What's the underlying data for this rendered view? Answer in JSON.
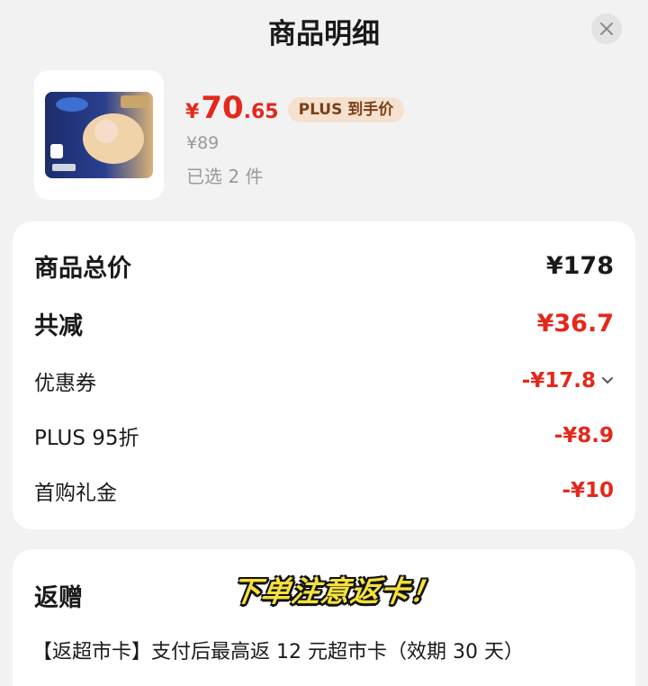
{
  "header": {
    "title": "商品明细",
    "close_icon": "close-icon"
  },
  "product": {
    "price_symbol": "¥",
    "price_integer": "70",
    "price_decimal": ".65",
    "plus_badge": "PLUS 到手价",
    "original_price": "¥89",
    "selected_count": "已选 2 件",
    "image_icon": "diaper-package-image"
  },
  "summary": {
    "total_label": "商品总价",
    "total_value": "¥178",
    "discount_label": "共减",
    "discount_value": "¥36.7",
    "coupon_label": "优惠券",
    "coupon_value": "-¥17.8",
    "plus_label": "PLUS 95折",
    "plus_value": "-¥8.9",
    "first_label": "首购礼金",
    "first_value": "-¥10"
  },
  "rebate": {
    "title": "返赠",
    "banner": "下单注意返卡！",
    "description": "【返超市卡】支付后最高返 12 元超市卡（效期 30 天）"
  },
  "colors": {
    "accent_red": "#e4281b",
    "badge_bg": "#f6e1d0",
    "badge_text": "#7a3f15",
    "banner_yellow": "#f5e13b"
  }
}
